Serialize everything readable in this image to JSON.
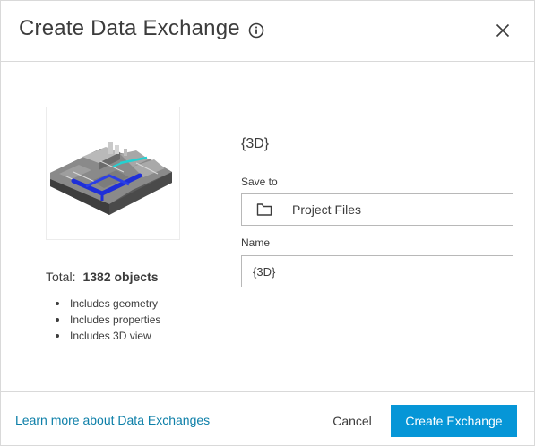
{
  "dialog": {
    "title": "Create Data Exchange",
    "info_icon": "info-circle-icon",
    "close_icon": "close-icon"
  },
  "summary": {
    "total_label": "Total:",
    "total_count": "1382 objects",
    "features": [
      "Includes geometry",
      "Includes properties",
      "Includes 3D view"
    ]
  },
  "form": {
    "exchange_name": "{3D}",
    "save_to_label": "Save to",
    "save_to_value": "Project Files",
    "save_to_icon": "folder-icon",
    "name_label": "Name",
    "name_value": "{3D}"
  },
  "footer": {
    "learn_more_link": "Learn more about Data Exchanges",
    "cancel_label": "Cancel",
    "create_label": "Create Exchange"
  },
  "colors": {
    "accent": "#0696d7",
    "link": "#0d7fa8",
    "border": "#d9d9d9"
  }
}
